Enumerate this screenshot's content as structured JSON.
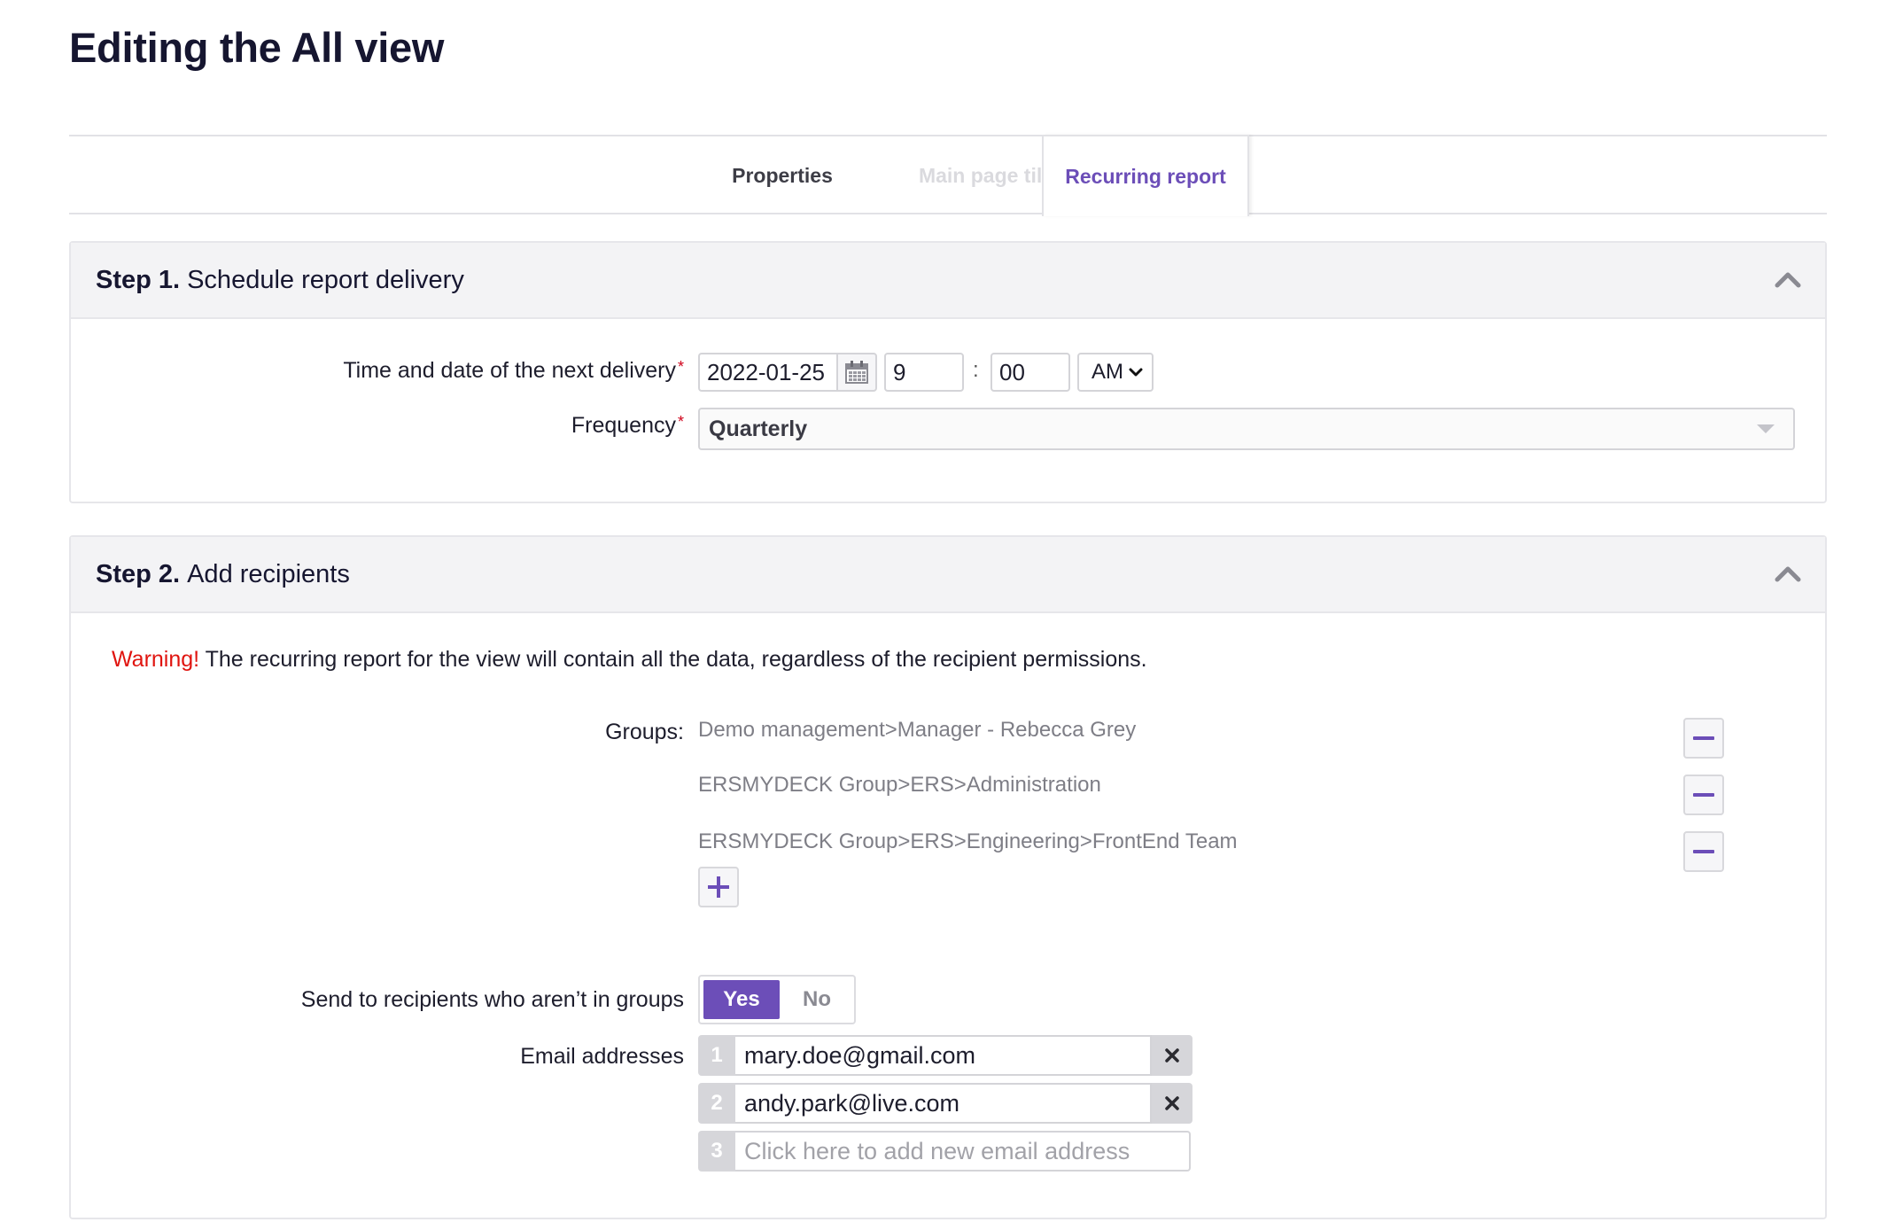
{
  "page": {
    "title": "Editing the All view"
  },
  "tabs": [
    {
      "label": "Properties",
      "state": "enabled"
    },
    {
      "label": "Main page tile",
      "state": "disabled"
    },
    {
      "label": "Recurring report",
      "state": "active"
    }
  ],
  "step1": {
    "step_label": "Step 1.",
    "title": "Schedule report delivery",
    "next_delivery_label": "Time and date of the next delivery",
    "date": "2022-01-25",
    "hour": "9",
    "time_separator": ":",
    "minute": "00",
    "ampm": "AM",
    "frequency_label": "Frequency",
    "frequency_value": "Quarterly",
    "required_mark": "*"
  },
  "step2": {
    "step_label": "Step 2.",
    "title": "Add recipients",
    "warning_word": "Warning!",
    "warning_text": " The recurring report for the view will contain all the data, regardless of the recipient permissions.",
    "groups_label": "Groups:",
    "groups": [
      "Demo management>Manager - Rebecca Grey",
      "ERSMYDECK Group>ERS>Administration",
      "ERSMYDECK Group>ERS>Engineering>FrontEnd Team"
    ],
    "send_label": "Send to recipients who aren’t in groups",
    "toggle_yes": "Yes",
    "toggle_no": "No",
    "toggle_selected": "Yes",
    "emails_label": "Email addresses",
    "emails": [
      {
        "num": "1",
        "address": "mary.doe@gmail.com"
      },
      {
        "num": "2",
        "address": "andy.park@live.com"
      }
    ],
    "new_email": {
      "num": "3",
      "placeholder": "Click here to add new email address"
    }
  },
  "colors": {
    "accent": "#6c4eb8",
    "warning": "#e0140f",
    "required": "#d0021b",
    "title": "#161630"
  }
}
